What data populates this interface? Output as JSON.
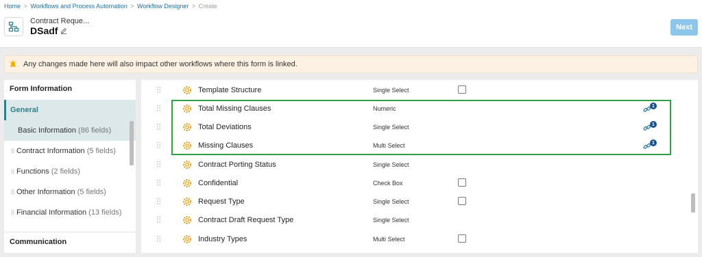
{
  "breadcrumb": {
    "items": [
      "Home",
      "Workflows and Process Automation",
      "Workflow Designer"
    ],
    "current": "Create",
    "separator": ">"
  },
  "header": {
    "subtitle": "Contract Reque...",
    "title": "DSadf",
    "form_icon": "workflow-icon",
    "next_label": "Next"
  },
  "banner": {
    "icon": "warning-icon",
    "text": "Any changes made here will also impact other workflows where this form is linked."
  },
  "sidebar": {
    "header": "Form Information",
    "section": "General",
    "selected_item": {
      "label": "Basic Information",
      "count": "(86 fields)"
    },
    "items": [
      {
        "label": "Contract Information",
        "count": "(5 fields)"
      },
      {
        "label": "Functions",
        "count": "(2 fields)"
      },
      {
        "label": "Other Information",
        "count": "(5 fields)"
      },
      {
        "label": "Financial Information",
        "count": "(13 fields)"
      }
    ],
    "footer": "Communication"
  },
  "fields": [
    {
      "name": "Template Structure",
      "type": "Single Select",
      "checkbox": true,
      "link_count": null
    },
    {
      "name": "Total Missing Clauses",
      "type": "Numeric",
      "checkbox": false,
      "link_count": "1"
    },
    {
      "name": "Total Deviations",
      "type": "Single Select",
      "checkbox": false,
      "link_count": "1"
    },
    {
      "name": "Missing Clauses",
      "type": "Multi Select",
      "checkbox": false,
      "link_count": "1"
    },
    {
      "name": "Contract Porting Status",
      "type": "Single Select",
      "checkbox": false,
      "link_count": null
    },
    {
      "name": "Confidential",
      "type": "Check Box",
      "checkbox": true,
      "link_count": null
    },
    {
      "name": "Request Type",
      "type": "Single Select",
      "checkbox": true,
      "link_count": null
    },
    {
      "name": "Contract Draft Request Type",
      "type": "Single Select",
      "checkbox": false,
      "link_count": null
    },
    {
      "name": "Industry Types",
      "type": "Multi Select",
      "checkbox": true,
      "link_count": null
    }
  ],
  "colors": {
    "accent": "#2f7f89",
    "link": "#1d6fa8",
    "next_button": "#8ec5ea",
    "highlight": "#2f9e44",
    "banner_bg": "#fdf1e4",
    "field_icon": "#e8a317",
    "badge": "#1a4f8a"
  }
}
